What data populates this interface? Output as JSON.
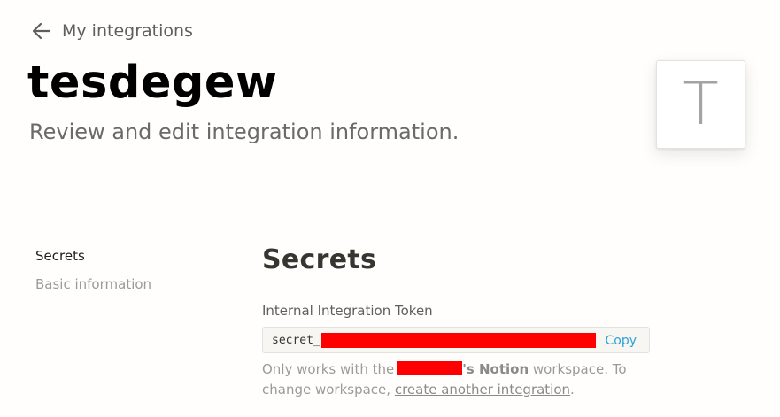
{
  "nav": {
    "back_label": "My integrations"
  },
  "header": {
    "title": "tesdegew",
    "subtitle": "Review and edit integration information.",
    "avatar_letter": "T"
  },
  "sidebar": {
    "items": [
      {
        "label": "Secrets",
        "active": true
      },
      {
        "label": "Basic information",
        "active": false
      }
    ]
  },
  "main": {
    "section_title": "Secrets",
    "token": {
      "label": "Internal Integration Token",
      "value_prefix": "secret_",
      "copy_label": "Copy"
    },
    "help": {
      "prefix": "Only works with the",
      "workspace_suffix": "'s Notion",
      "middle": "workspace. To change workspace,",
      "link_text": "create another integration",
      "end": "."
    }
  },
  "colors": {
    "accent_link": "#2ea2d6",
    "redaction": "#ff0000",
    "background": "#fffefc"
  },
  "icons": {
    "back": "arrow-left-icon"
  }
}
